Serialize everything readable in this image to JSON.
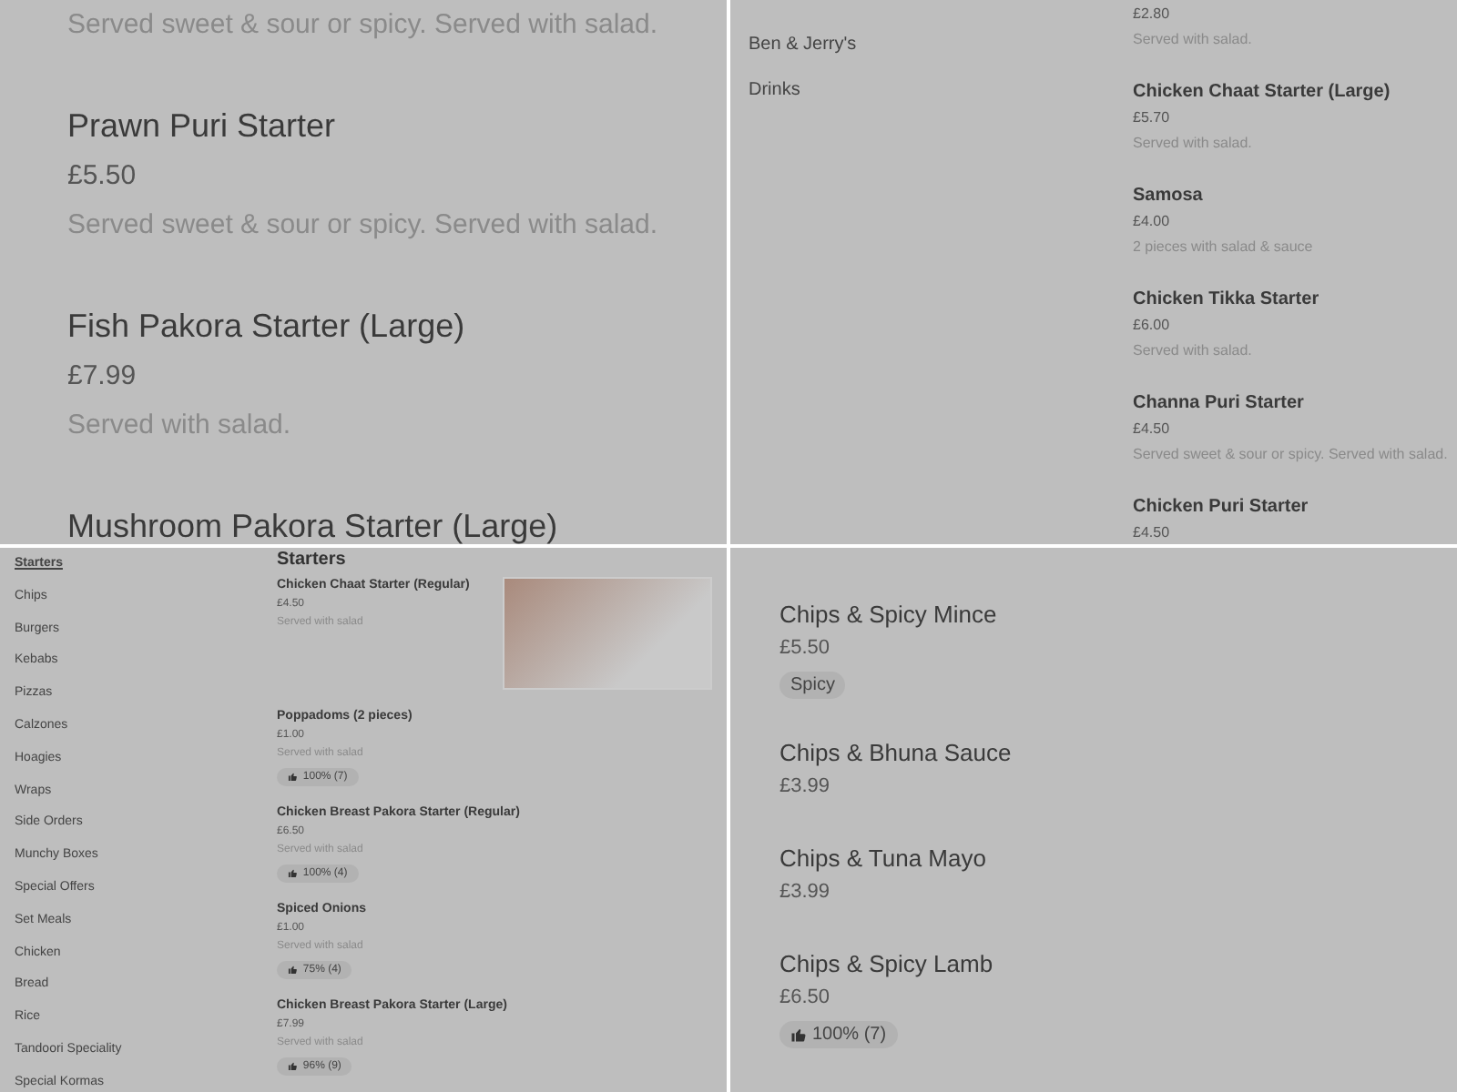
{
  "panels": [
    {
      "kind": "large-list",
      "items": [
        {
          "description": "Served sweet & sour or spicy. Served with salad."
        },
        {
          "name": "Prawn Puri Starter",
          "price": "£5.50",
          "description": "Served sweet & sour or spicy. Served with salad."
        },
        {
          "name": "Fish Pakora Starter (Large)",
          "price": "£7.99",
          "description": "Served with salad."
        },
        {
          "name": "Mushroom Pakora Starter (Large)"
        }
      ]
    },
    {
      "kind": "menu",
      "nav": [
        {
          "label": "Ben & Jerry's",
          "selected": false
        },
        {
          "label": "Drinks",
          "selected": false
        }
      ],
      "items": [
        {
          "price": "£2.80",
          "description": "Served with salad."
        },
        {
          "name": "Chicken Chaat Starter (Large)",
          "price": "£5.70",
          "description": "Served with salad."
        },
        {
          "name": "Samosa",
          "price": "£4.00",
          "description": "2 pieces with salad & sauce"
        },
        {
          "name": "Chicken Tikka Starter",
          "price": "£6.00",
          "description": "Served with salad."
        },
        {
          "name": "Channa Puri Starter",
          "price": "£4.50",
          "description": "Served sweet & sour or spicy. Served with salad."
        },
        {
          "name": "Chicken Puri Starter",
          "price": "£4.50"
        }
      ]
    },
    {
      "kind": "menu-small",
      "nav": [
        {
          "label": "Starters",
          "selected": true
        },
        {
          "label": "Chips",
          "selected": false
        },
        {
          "label": "Burgers",
          "selected": false
        },
        {
          "label": "Kebabs",
          "selected": false
        },
        {
          "label": "Pizzas",
          "selected": false
        },
        {
          "label": "Calzones",
          "selected": false
        },
        {
          "label": "Hoagies",
          "selected": false
        },
        {
          "label": "Wraps",
          "selected": false
        },
        {
          "label": "Side Orders",
          "selected": false
        },
        {
          "label": "Munchy Boxes",
          "selected": false
        },
        {
          "label": "Special Offers",
          "selected": false
        },
        {
          "label": "Set Meals",
          "selected": false
        },
        {
          "label": "Chicken",
          "selected": false
        },
        {
          "label": "Bread",
          "selected": false
        },
        {
          "label": "Rice",
          "selected": false
        },
        {
          "label": "Tandoori Speciality",
          "selected": false
        },
        {
          "label": "Special Kormas",
          "selected": false
        }
      ],
      "heading": "Starters",
      "items": [
        {
          "name": "Chicken Chaat Starter (Regular)",
          "price": "£4.50",
          "description": "Served with salad",
          "photo": true
        },
        {
          "name": "Poppadoms (2 pieces)",
          "price": "£1.00",
          "description": "Served with salad",
          "tags": [
            {
              "kind": "rating",
              "text": "100% (7)"
            }
          ]
        },
        {
          "name": "Chicken Breast Pakora Starter (Regular)",
          "price": "£6.50",
          "description": "Served with salad",
          "tags": [
            {
              "kind": "rating",
              "text": "100% (4)"
            }
          ]
        },
        {
          "name": "Spiced Onions",
          "price": "£1.00",
          "description": "Served with salad",
          "tags": [
            {
              "kind": "rating",
              "text": "75% (4)"
            }
          ]
        },
        {
          "name": "Chicken Breast Pakora Starter (Large)",
          "price": "£7.99",
          "description": "Served with salad",
          "tags": [
            {
              "kind": "rating",
              "text": "96% (9)"
            }
          ]
        }
      ]
    },
    {
      "kind": "medium-list",
      "items": [
        {
          "name": "Chips & Spicy Mince",
          "price": "£5.50",
          "tags": [
            {
              "kind": "label",
              "text": "Spicy"
            }
          ]
        },
        {
          "name": "Chips & Bhuna Sauce",
          "price": "£3.99"
        },
        {
          "name": "Chips & Tuna Mayo",
          "price": "£3.99"
        },
        {
          "name": "Chips & Spicy Lamb",
          "price": "£6.50",
          "tags": [
            {
              "kind": "rating",
              "text": "100% (7)"
            }
          ]
        }
      ]
    }
  ]
}
